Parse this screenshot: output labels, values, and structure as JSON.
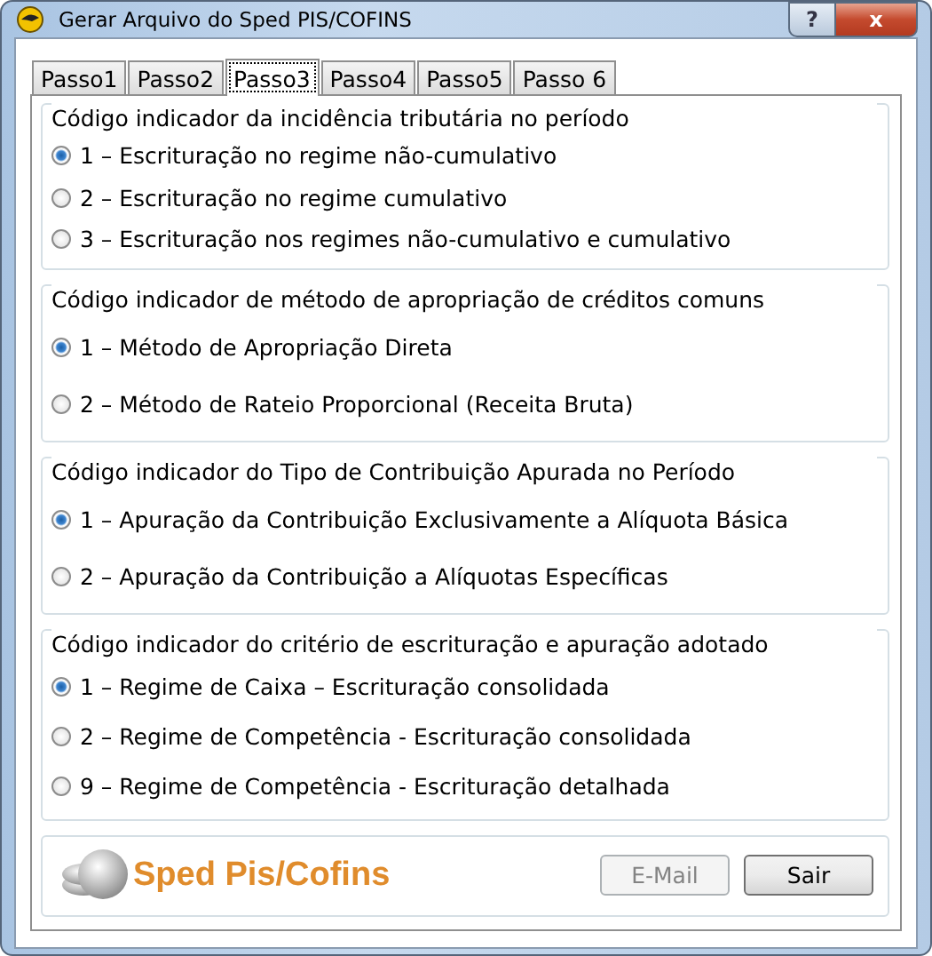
{
  "window": {
    "title": "Gerar Arquivo do Sped PIS/COFINS",
    "help_button": "?",
    "close_button": "x"
  },
  "tabs": [
    {
      "label": "Passo1",
      "selected": false
    },
    {
      "label": "Passo2",
      "selected": false
    },
    {
      "label": "Passo3",
      "selected": true
    },
    {
      "label": "Passo4",
      "selected": false
    },
    {
      "label": "Passo5",
      "selected": false
    },
    {
      "label": "Passo 6",
      "selected": false
    }
  ],
  "groups": [
    {
      "title": "Código indicador da incidência tributária no período",
      "options": [
        {
          "label": "1 – Escrituração no regime não-cumulativo",
          "selected": true
        },
        {
          "label": "2 – Escrituração no regime cumulativo",
          "selected": false
        },
        {
          "label": "3 – Escrituração nos regimes não-cumulativo e cumulativo",
          "selected": false
        }
      ]
    },
    {
      "title": "Código indicador de método de apropriação de créditos comuns",
      "options": [
        {
          "label": "1 – Método de Apropriação Direta",
          "selected": true
        },
        {
          "label": "2 – Método de Rateio Proporcional (Receita Bruta)",
          "selected": false
        }
      ]
    },
    {
      "title": "Código indicador do Tipo de Contribuição Apurada no Período",
      "options": [
        {
          "label": "1 – Apuração da Contribuição Exclusivamente a Alíquota Básica",
          "selected": true
        },
        {
          "label": "2 – Apuração da Contribuição a Alíquotas Específicas",
          "selected": false
        }
      ]
    },
    {
      "title": "Código indicador do critério de escrituração e apuração adotado",
      "options": [
        {
          "label": "1 – Regime de Caixa – Escrituração consolidada",
          "selected": true
        },
        {
          "label": "2 – Regime de Competência - Escrituração consolidada",
          "selected": false
        },
        {
          "label": "9 – Regime de Competência - Escrituração detalhada",
          "selected": false
        }
      ]
    }
  ],
  "footer": {
    "logo_text": "Sped Pis/Cofins",
    "buttons": [
      {
        "label": "E-Mail",
        "disabled": true
      },
      {
        "label": "Sair",
        "disabled": false
      }
    ]
  }
}
